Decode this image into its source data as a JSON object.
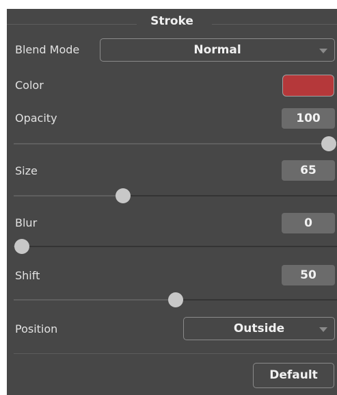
{
  "panel": {
    "title": "Stroke"
  },
  "blend_mode": {
    "label": "Blend Mode",
    "value": "Normal"
  },
  "color": {
    "label": "Color",
    "swatch_hex": "#b5383a"
  },
  "opacity": {
    "label": "Opacity",
    "value": "100",
    "slider_fraction": 1.0
  },
  "size": {
    "label": "Size",
    "value": "65",
    "slider_fraction": 0.33
  },
  "blur": {
    "label": "Blur",
    "value": "0",
    "slider_fraction": 0.0
  },
  "shift": {
    "label": "Shift",
    "value": "50",
    "slider_fraction": 0.5
  },
  "position": {
    "label": "Position",
    "value": "Outside"
  },
  "footer": {
    "default_label": "Default"
  },
  "icons": [
    "chevron-down-icon",
    "chevron-down-icon"
  ]
}
